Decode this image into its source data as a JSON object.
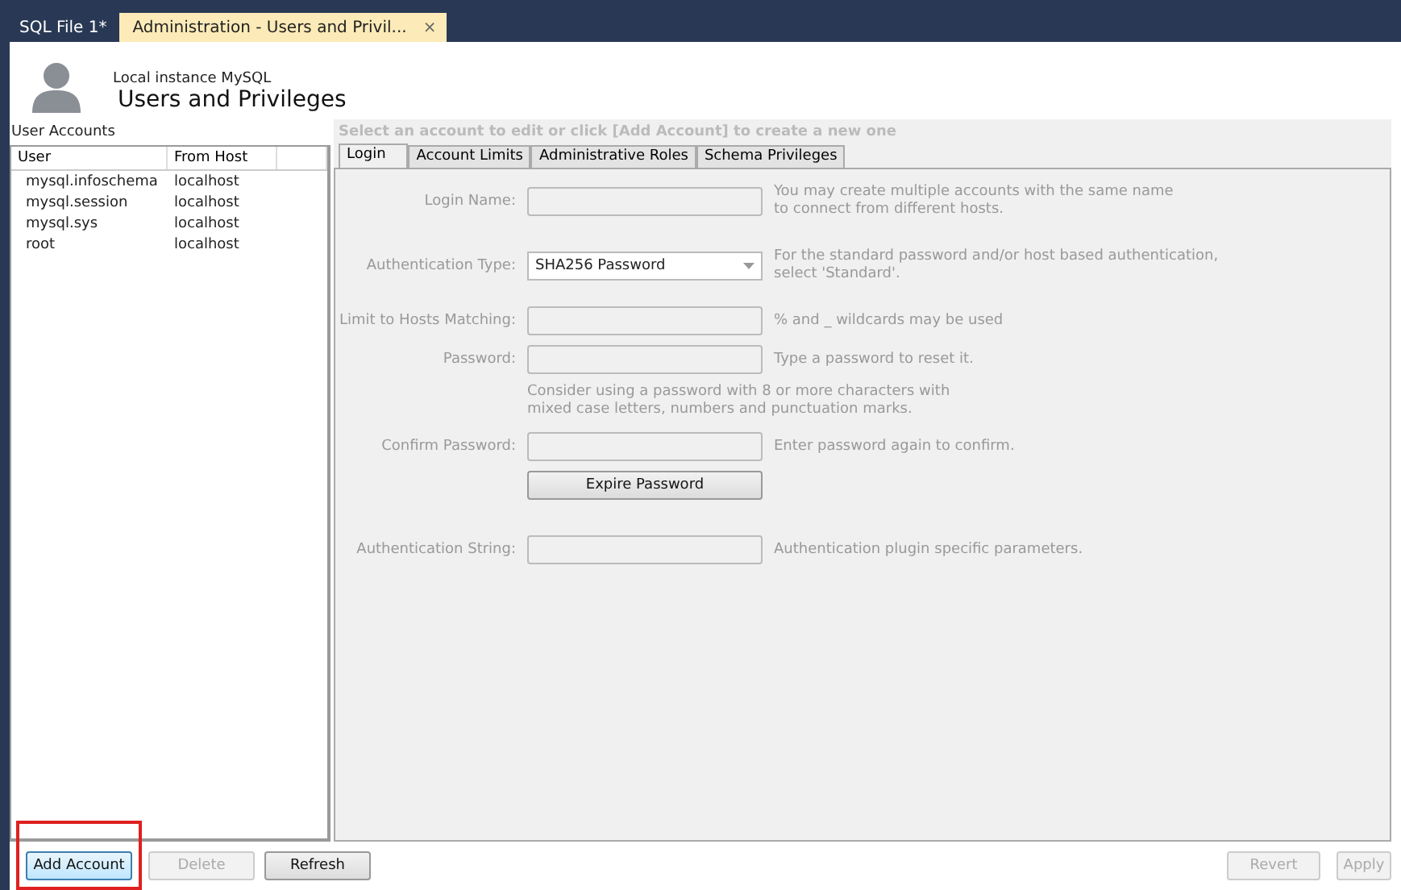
{
  "doc_tabs": [
    {
      "label": "SQL File 1*",
      "selected": false
    },
    {
      "label": "Administration - Users and Privil...",
      "selected": true,
      "close": "×"
    }
  ],
  "header": {
    "subtitle": "Local instance MySQL",
    "title": "Users and Privileges"
  },
  "accounts": {
    "title": "User Accounts",
    "columns": [
      "User",
      "From Host"
    ],
    "rows": [
      {
        "user": "mysql.infoschema",
        "host": "localhost"
      },
      {
        "user": "mysql.session",
        "host": "localhost"
      },
      {
        "user": "mysql.sys",
        "host": "localhost"
      },
      {
        "user": "root",
        "host": "localhost"
      }
    ]
  },
  "detail": {
    "prompt": "Select an account to edit or click [Add Account] to create a new one",
    "tabs": [
      {
        "label": "Login",
        "selected": true
      },
      {
        "label": "Account Limits",
        "selected": false
      },
      {
        "label": "Administrative Roles",
        "selected": false
      },
      {
        "label": "Schema Privileges",
        "selected": false
      }
    ],
    "fields": [
      {
        "kind": "input",
        "label": "Login Name:",
        "hint": "You may create multiple accounts with the same name\nto connect from different hosts."
      },
      {
        "kind": "select",
        "label": "Authentication Type:",
        "value": "SHA256 Password",
        "hint": "For the standard password and/or host based authentication,\nselect 'Standard'."
      },
      {
        "kind": "input",
        "label": "Limit to Hosts Matching:",
        "hint": "% and _ wildcards may be used"
      },
      {
        "kind": "input",
        "label": "Password:",
        "hint": "Type a password to reset it."
      },
      {
        "kind": "note",
        "text": "Consider using a password with 8 or more characters with\nmixed case letters, numbers and punctuation marks."
      },
      {
        "kind": "input",
        "label": "Confirm Password:",
        "hint": "Enter password again to confirm."
      },
      {
        "kind": "button",
        "label": "Expire Password"
      },
      {
        "kind": "input",
        "label": "Authentication String:",
        "hint": "Authentication plugin specific parameters."
      }
    ]
  },
  "left_buttons": [
    {
      "label": "Add Account",
      "disabled": false,
      "highlighted": true
    },
    {
      "label": "Delete",
      "disabled": true,
      "highlighted": false
    },
    {
      "label": "Refresh",
      "disabled": false,
      "highlighted": false
    }
  ],
  "right_buttons": [
    {
      "label": "Revert",
      "disabled": true
    },
    {
      "label": "Apply",
      "disabled": true
    }
  ]
}
